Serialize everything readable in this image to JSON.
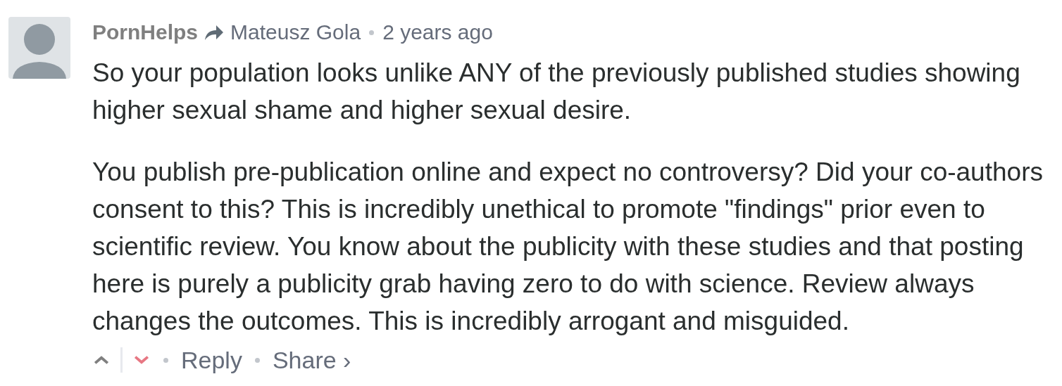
{
  "comment": {
    "author": "PornHelps",
    "reply_to": "Mateusz Gola",
    "time": "2 years ago",
    "paragraphs": [
      "So your population looks unlike ANY of the previously published studies showing higher sexual shame and higher sexual desire.",
      "You publish pre-publication online and expect no controversy? Did your co-authors consent to this? This is incredibly unethical to promote \"findings\" prior even to scientific review. You know about the publicity with these studies and that posting here is purely a publicity grab having zero to do with science. Review always changes the outcomes. This is incredibly arrogant and misguided."
    ],
    "upvoted": false,
    "downvoted": true,
    "reply": "Reply",
    "share": "Share ›"
  }
}
